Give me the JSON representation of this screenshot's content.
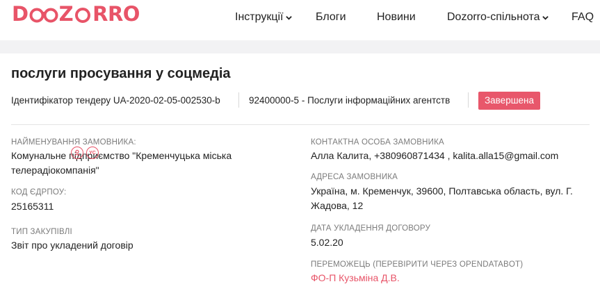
{
  "header": {
    "logo_text_left": "D",
    "logo_text_mid": "Z",
    "logo_text_right": "RRO",
    "nav": [
      {
        "label": "Інструкції",
        "dropdown": true
      },
      {
        "label": "Блоги",
        "dropdown": false
      },
      {
        "label": "Новини",
        "dropdown": false
      },
      {
        "label": "Dozorro-спільнота",
        "dropdown": true
      },
      {
        "label": "FAQ",
        "dropdown": false
      }
    ]
  },
  "tender": {
    "title": "послуги просування у соцмедіа",
    "id_text": "Ідентифікатор тендеру UA-2020-02-05-002530-b",
    "cpv_text": "92400000-5 - Послуги інформаційних агентств",
    "status": "Завершена"
  },
  "left": {
    "customer_label": "НАЙМЕНУВАННЯ ЗАМОВНИКА:",
    "customer_value": "Комунальне підприємство \"Кременчуцька міська телерадіокомпанія\"",
    "edrpou_label": "КОД ЄДРПОУ:",
    "edrpou_value": "25165311",
    "yc_icon_text": "YC",
    "type_label": "ТИП ЗАКУПІВЛІ",
    "type_value": "Звіт про укладений договір"
  },
  "right": {
    "contact_label": "КОНТАКТНА ОСОБА ЗАМОВНИКА",
    "contact_value": "Алла Калита, +380960871434 , kalita.alla15@gmail.com",
    "address_label": "АДРЕСА ЗАМОВНИКА",
    "address_value": "Україна, м. Кременчук, 39600, Полтавська область, вул. Г. Жадова, 12",
    "date_label": "ДАТА УКЛАДЕННЯ ДОГОВОРУ",
    "date_value": "5.02.20",
    "winner_label": "ПЕРЕМОЖЕЦЬ (ПЕРЕВІРИТИ ЧЕРЕЗ OPENDATABOT)",
    "winner_value": "ФО-П Кузьміна Д.В."
  },
  "colors": {
    "accent": "#e85468",
    "badge": "#e8576b"
  }
}
